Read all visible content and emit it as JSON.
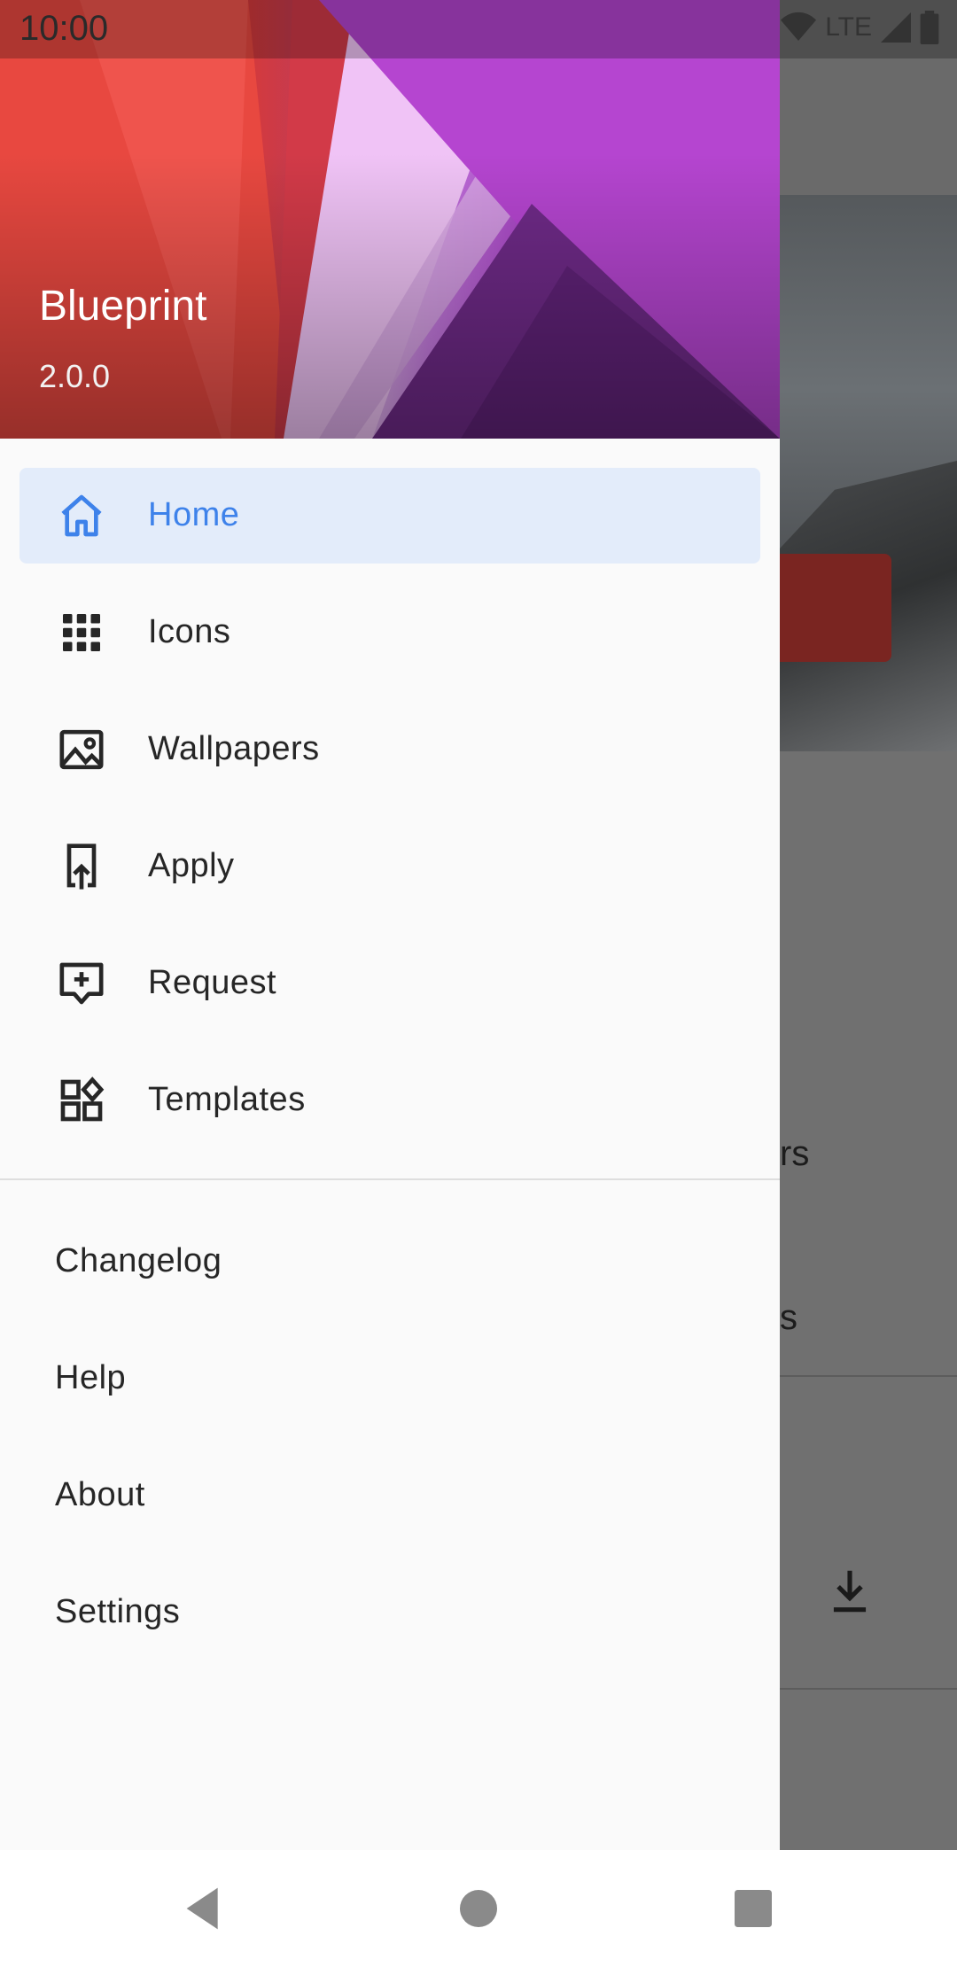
{
  "status_bar": {
    "time": "10:00",
    "network": "LTE",
    "icons": [
      "wifi-icon",
      "signal-icon",
      "battery-icon"
    ]
  },
  "background_screen": {
    "partial_texts": [
      "rs",
      "s"
    ],
    "icons": [
      "download-icon"
    ],
    "accent_color": "#c62828"
  },
  "drawer": {
    "header": {
      "title": "Blueprint",
      "version": "2.0.0"
    },
    "primary_items": [
      {
        "label": "Home",
        "icon": "home-icon",
        "selected": true
      },
      {
        "label": "Icons",
        "icon": "apps-grid-icon",
        "selected": false
      },
      {
        "label": "Wallpapers",
        "icon": "image-icon",
        "selected": false
      },
      {
        "label": "Apply",
        "icon": "apply-icon",
        "selected": false
      },
      {
        "label": "Request",
        "icon": "request-icon",
        "selected": false
      },
      {
        "label": "Templates",
        "icon": "templates-icon",
        "selected": false
      }
    ],
    "secondary_items": [
      {
        "label": "Changelog"
      },
      {
        "label": "Help"
      },
      {
        "label": "About"
      },
      {
        "label": "Settings"
      }
    ],
    "selected_color": "#3e82ea",
    "selected_bg": "#e3ecfa"
  },
  "navigation_bar": {
    "buttons": [
      "back-icon",
      "home-circle-icon",
      "recents-icon"
    ]
  }
}
